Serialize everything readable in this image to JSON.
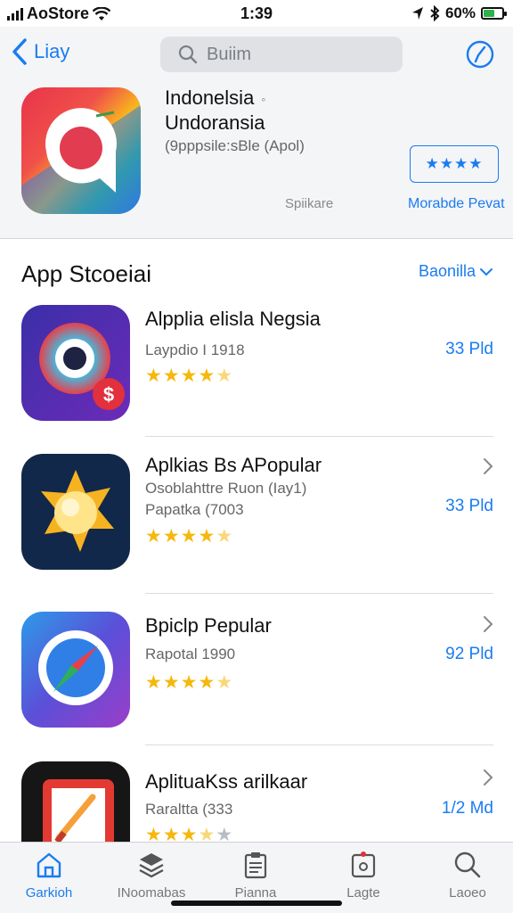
{
  "status_bar": {
    "carrier": "AoStore",
    "time": "1:39",
    "battery": "60%",
    "battery_level": 0.6
  },
  "nav": {
    "back_label": "Liay",
    "search_placeholder": "Buiim"
  },
  "featured": {
    "title": "Indonelsia",
    "subtitle": "Undoransia",
    "meta": "(9pppsile:sBle (Apol)",
    "rating_stars": "★★★★",
    "label_spotlight": "Spiikare",
    "label_more": "Morabde Pevat"
  },
  "section": {
    "title": "App Stcoeiai",
    "link": "Baonilla"
  },
  "apps": [
    {
      "name": "Alpplia elisla Negsia",
      "line1": "Laypdio I 1918",
      "line2": "",
      "price": "33 Pld",
      "rating": 4.5,
      "chevron": false
    },
    {
      "name": "Aplkias Bs APopular",
      "line1": "Osoblahttre Ruon (Iay1)",
      "line2": "Papatka (7003",
      "price": "33 Pld",
      "rating": 4.5,
      "chevron": true
    },
    {
      "name": "Bpiclp Pepular",
      "line1": "Rapotal 1990",
      "line2": "",
      "price": "92 Pld",
      "rating": 4.5,
      "chevron": true
    },
    {
      "name": "AplituaKss arilkaar",
      "line1": "Raraltta (333",
      "line2": "",
      "price": "1/2 Md",
      "rating": 3.5,
      "chevron": true
    }
  ],
  "tabs": [
    {
      "label": "Garkioh",
      "icon": "home-icon",
      "active": true
    },
    {
      "label": "INoomabas",
      "icon": "apps-stack-icon",
      "active": false
    },
    {
      "label": "Pianna",
      "icon": "clipboard-icon",
      "active": false
    },
    {
      "label": "Lagte",
      "icon": "updates-icon",
      "active": false
    },
    {
      "label": "Laoeo",
      "icon": "search-icon",
      "active": false
    }
  ],
  "colors": {
    "accent": "#1a7cf0",
    "star": "#f5b80c",
    "battery": "#2db14a"
  }
}
